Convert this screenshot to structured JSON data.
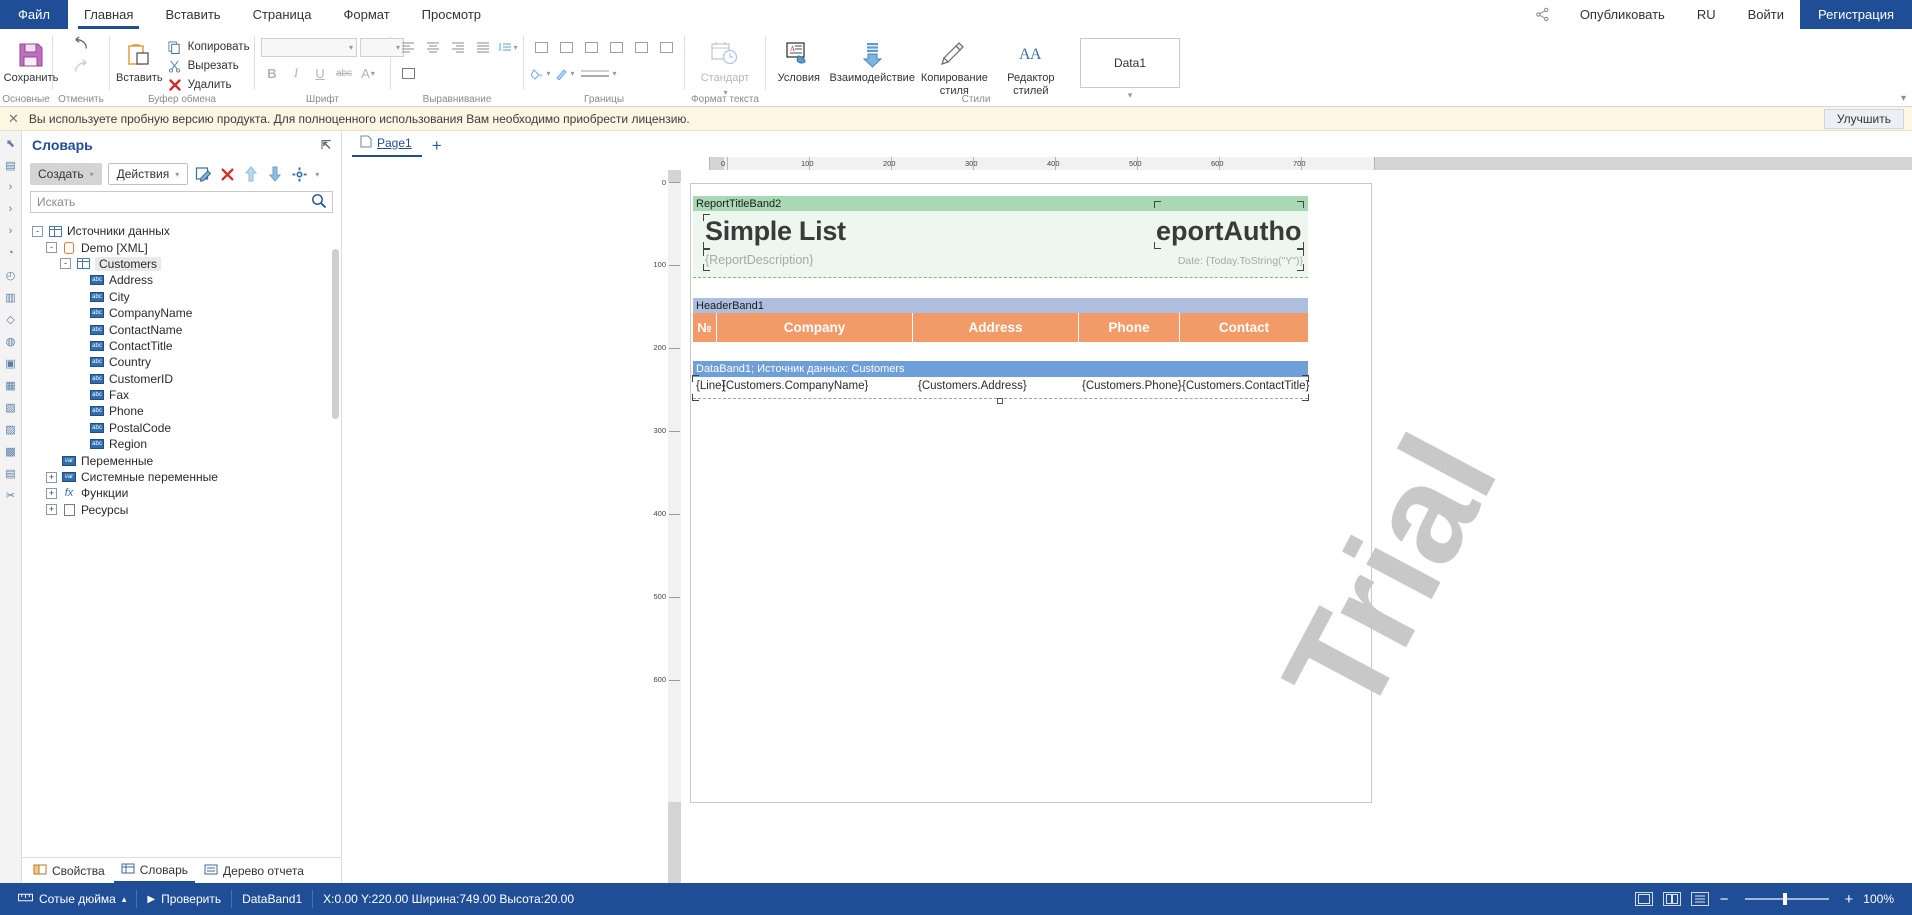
{
  "menubar": {
    "file": "Файл",
    "items": [
      "Главная",
      "Вставить",
      "Страница",
      "Формат",
      "Просмотр"
    ],
    "active_index": 0,
    "right": {
      "share_icon": "share-icon",
      "publish": "Опубликовать",
      "lang": "RU",
      "login": "Войти",
      "register": "Регистрация"
    }
  },
  "ribbon": {
    "groups": [
      {
        "label": "Основные",
        "buttons": [
          {
            "label": "Сохранить",
            "icon": "save-icon"
          }
        ]
      },
      {
        "label": "Отменить",
        "buttons": [
          {
            "label": "",
            "icon": "undo-icon"
          },
          {
            "label": "",
            "icon": "redo-icon"
          }
        ]
      },
      {
        "label": "Буфер обмена",
        "buttons": [
          {
            "label": "Вставить",
            "icon": "paste-icon"
          }
        ],
        "small": [
          {
            "label": "Копировать",
            "icon": "copy-icon"
          },
          {
            "label": "Вырезать",
            "icon": "cut-icon"
          },
          {
            "label": "Удалить",
            "icon": "delete-icon"
          }
        ]
      },
      {
        "label": "Шрифт",
        "font_name": "",
        "font_size": "",
        "bold": "B",
        "italic": "I",
        "underline": "U",
        "strike": "abc",
        "text_color": "A"
      },
      {
        "label": "Выравнивание"
      },
      {
        "label": "Границы"
      },
      {
        "label": "Формат текста",
        "buttons": [
          {
            "label": "Стандарт",
            "icon": "datetime-format-icon"
          }
        ]
      },
      {
        "label": "Стили",
        "buttons": [
          {
            "label": "Условия",
            "icon": "conditions-icon"
          },
          {
            "label": "Взаимодействие",
            "icon": "interaction-icon"
          },
          {
            "label": "Копирование стиля",
            "icon": "style-copy-icon"
          },
          {
            "label": "Редактор стилей",
            "icon": "style-editor-icon"
          }
        ],
        "current_style": "Data1"
      }
    ]
  },
  "trial": {
    "close_icon": "close-icon",
    "message": "Вы используете пробную версию продукта. Для полноценного использования Вам необходимо приобрести лицензию.",
    "improve_button": "Улучшить"
  },
  "dictionary": {
    "title": "Словарь",
    "pin_icon": "pin-icon",
    "toolbar": {
      "create": "Создать",
      "actions": "Действия",
      "edit_icon": "edit-icon",
      "delete_icon": "delete-red-icon",
      "up_icon": "arrow-up-icon",
      "down_icon": "arrow-down-icon",
      "settings_icon": "gear-icon"
    },
    "search_placeholder": "Искать",
    "search_value": "",
    "search_icon": "search-icon",
    "tree": [
      {
        "label": "Источники данных",
        "depth": 0,
        "toggle": "-",
        "icon": "table-icon",
        "selected": false
      },
      {
        "label": "Demo [XML]",
        "depth": 1,
        "toggle": "-",
        "icon": "database-icon",
        "selected": false
      },
      {
        "label": "Customers",
        "depth": 2,
        "toggle": "-",
        "icon": "table-icon",
        "selected": true
      },
      {
        "label": "Address",
        "depth": 3,
        "toggle": "",
        "icon": "abc-icon",
        "selected": false
      },
      {
        "label": "City",
        "depth": 3,
        "toggle": "",
        "icon": "abc-icon",
        "selected": false
      },
      {
        "label": "CompanyName",
        "depth": 3,
        "toggle": "",
        "icon": "abc-icon",
        "selected": false
      },
      {
        "label": "ContactName",
        "depth": 3,
        "toggle": "",
        "icon": "abc-icon",
        "selected": false
      },
      {
        "label": "ContactTitle",
        "depth": 3,
        "toggle": "",
        "icon": "abc-icon",
        "selected": false
      },
      {
        "label": "Country",
        "depth": 3,
        "toggle": "",
        "icon": "abc-icon",
        "selected": false
      },
      {
        "label": "CustomerID",
        "depth": 3,
        "toggle": "",
        "icon": "abc-icon",
        "selected": false
      },
      {
        "label": "Fax",
        "depth": 3,
        "toggle": "",
        "icon": "abc-icon",
        "selected": false
      },
      {
        "label": "Phone",
        "depth": 3,
        "toggle": "",
        "icon": "abc-icon",
        "selected": false
      },
      {
        "label": "PostalCode",
        "depth": 3,
        "toggle": "",
        "icon": "abc-icon",
        "selected": false
      },
      {
        "label": "Region",
        "depth": 3,
        "toggle": "",
        "icon": "abc-icon",
        "selected": false
      },
      {
        "label": "Переменные",
        "depth": 1,
        "toggle": "",
        "icon": "var-icon",
        "selected": false
      },
      {
        "label": "Системные переменные",
        "depth": 1,
        "toggle": "+",
        "icon": "var-icon",
        "selected": false
      },
      {
        "label": "Функции",
        "depth": 1,
        "toggle": "+",
        "icon": "fx-icon",
        "selected": false
      },
      {
        "label": "Ресурсы",
        "depth": 1,
        "toggle": "+",
        "icon": "resource-icon",
        "selected": false
      }
    ],
    "tabs": [
      {
        "label": "Свойства",
        "icon": "properties-icon",
        "active": false
      },
      {
        "label": "Словарь",
        "icon": "dictionary-icon",
        "active": true
      },
      {
        "label": "Дерево отчета",
        "icon": "report-tree-icon",
        "active": false
      }
    ]
  },
  "workspace": {
    "page_tab": "Page1",
    "page_tab_icon": "page-icon",
    "add_page": "+",
    "hruler_ticks": [
      "0",
      "100",
      "200",
      "300",
      "400",
      "500",
      "600",
      "700"
    ],
    "vruler_ticks": [
      "0",
      "100",
      "200",
      "300",
      "400",
      "500",
      "600"
    ],
    "bands": [
      {
        "name": "ReportTitleBand2",
        "type": "report-title"
      },
      {
        "name": "HeaderBand1",
        "type": "header"
      },
      {
        "name": "DataBand1; Источник данных: Customers",
        "type": "data"
      }
    ],
    "report": {
      "title": "Simple List",
      "author_expression": "eportAuthor}",
      "description_expression": "{ReportDescription}",
      "date_expression": "Date: {Today.ToString(\"Y\")}",
      "header_columns": [
        "№",
        "Company",
        "Address",
        "Phone",
        "Contact"
      ],
      "data_cells": [
        "{Line}",
        "{Customers.CompanyName}",
        "{Customers.Address}",
        "{Customers.Phone}",
        "{Customers.ContactTitle}"
      ]
    },
    "watermark": "Trial"
  },
  "statusbar": {
    "units": "Сотые дюйма",
    "units_caret": "caret-up-icon",
    "preview_icon": "play-icon",
    "preview": "Проверить",
    "selected_object": "DataBand1",
    "coords": "X:0.00 Y:220.00 Ширина:749.00 Высота:20.00",
    "view_icons": [
      "page-view-icon",
      "grid-view-icon",
      "list-view-icon"
    ],
    "zoom_out": "−",
    "zoom_in": "+",
    "zoom": "100%"
  },
  "colors": {
    "brand": "#1f4e96",
    "report_title_band": "#a8d8b4",
    "header_band": "#adbede",
    "data_band": "#6f9fd8",
    "table_header": "#f29a68",
    "trial_bg": "#fdf6e3"
  }
}
